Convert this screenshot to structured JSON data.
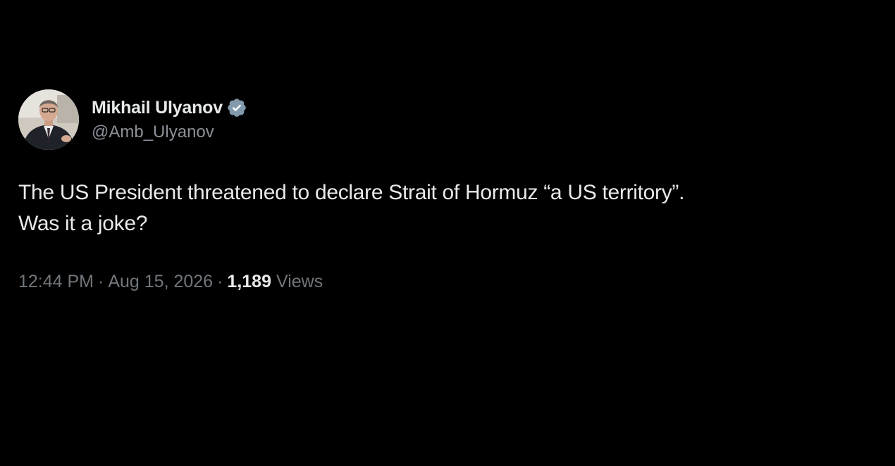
{
  "author": {
    "display_name": "Mikhail Ulyanov",
    "handle": "@Amb_Ulyanov",
    "verified": true,
    "avatar_icon": "profile-photo-icon",
    "verified_icon": "verified-badge-icon",
    "verified_color": "#829aab"
  },
  "tweet": {
    "text_line_1": "The US President threatened to declare Strait of Hormuz “a US territory”.",
    "text_line_2": "Was it a joke?"
  },
  "meta": {
    "time": "12:44 PM",
    "separator": "·",
    "date": "Aug 15, 2026",
    "views_count": "1,189",
    "views_label": "Views"
  },
  "colors": {
    "background": "#000000",
    "primary_text": "#e7e9ea",
    "secondary_text": "#71767b"
  }
}
